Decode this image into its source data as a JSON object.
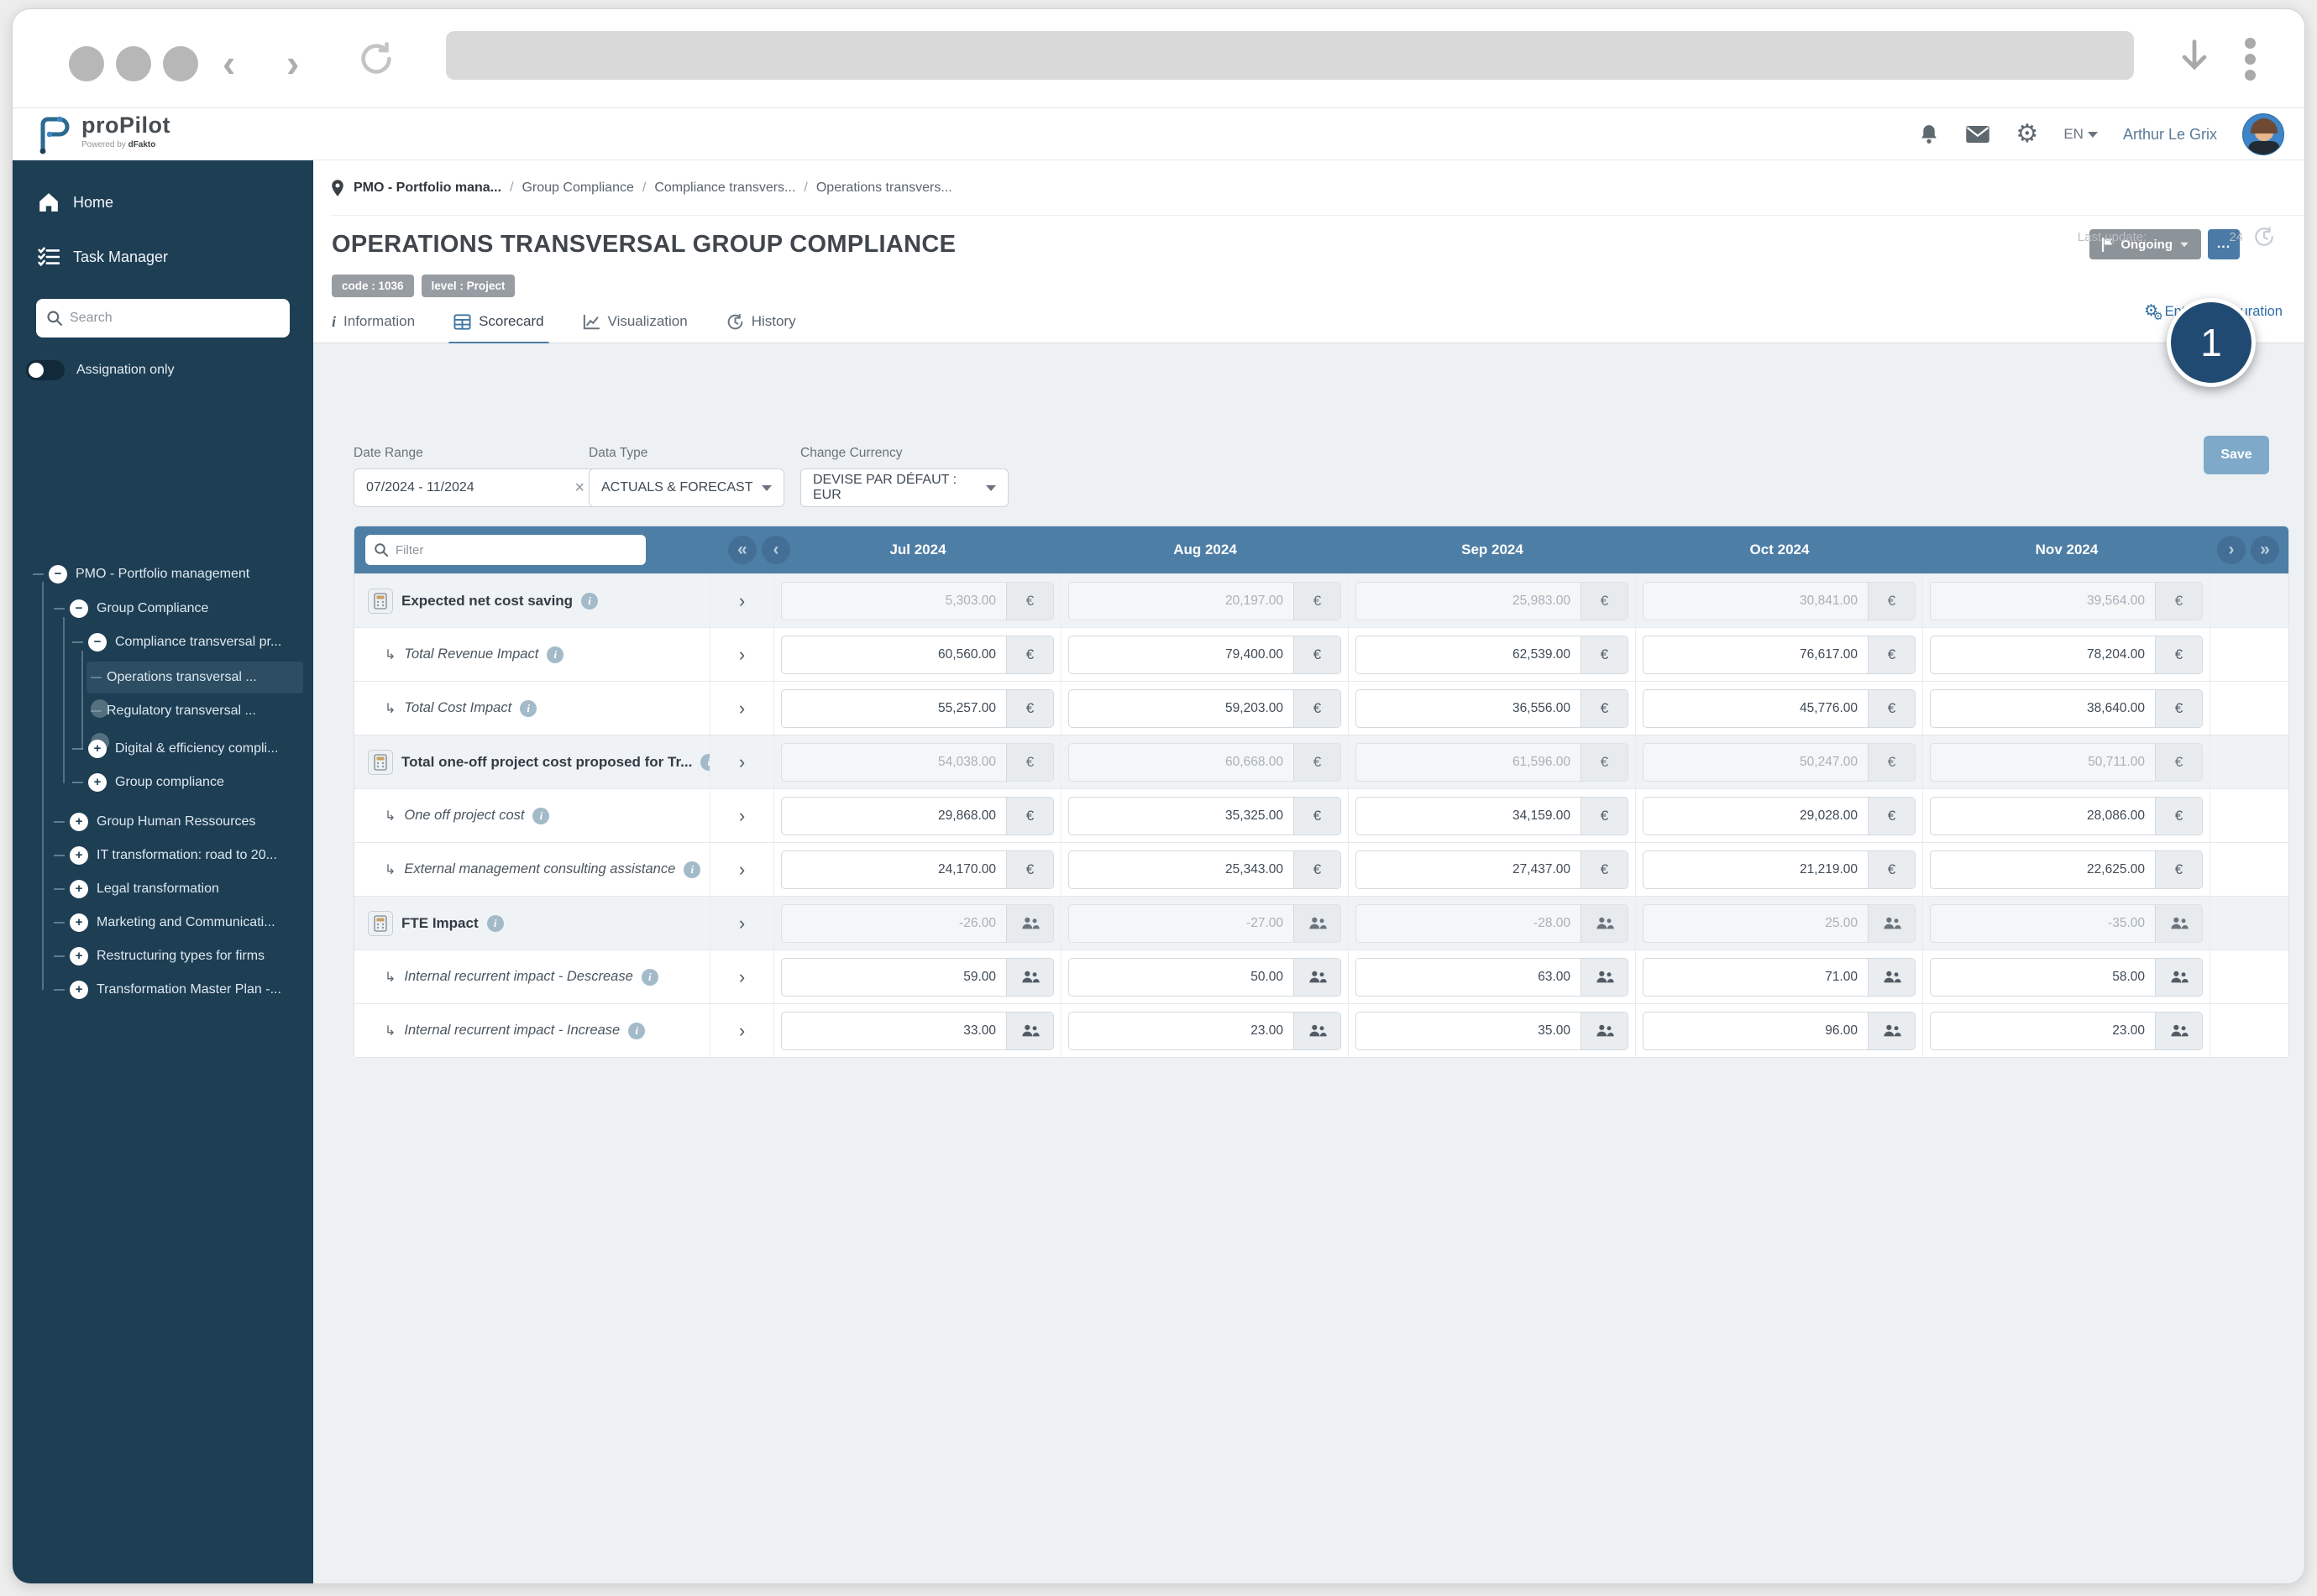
{
  "header": {
    "logo_text": "proPilot",
    "logo_sub_prefix": "Powered by ",
    "logo_sub_brand": "dFakto",
    "language": "EN",
    "user_name": "Arthur Le Grix"
  },
  "sidebar": {
    "home_label": "Home",
    "task_manager_label": "Task Manager",
    "search_placeholder": "Search",
    "toggle_label": "Assignation only",
    "tree": [
      {
        "label": "PMO - Portfolio management"
      },
      {
        "label": "Group Compliance"
      },
      {
        "label": "Compliance transversal pr..."
      },
      {
        "label": "Operations transversal ..."
      },
      {
        "label": "Regulatory transversal ..."
      },
      {
        "label": "Digital & efficiency compli..."
      },
      {
        "label": "Group compliance"
      },
      {
        "label": "Group Human Ressources"
      },
      {
        "label": "IT transformation: road to 20..."
      },
      {
        "label": "Legal transformation"
      },
      {
        "label": "Marketing and Communicati..."
      },
      {
        "label": "Restructuring types for firms"
      },
      {
        "label": "Transformation Master Plan -..."
      }
    ]
  },
  "breadcrumb": {
    "items": [
      "PMO - Portfolio mana...",
      "Group Compliance",
      "Compliance transvers...",
      "Operations transvers..."
    ],
    "separator": "/"
  },
  "page": {
    "title": "OPERATIONS TRANSVERSAL GROUP COMPLIANCE",
    "badges": [
      "code : 1036",
      "level : Project"
    ],
    "status_label": "Ongoing",
    "more_label": "...",
    "entity_config_label": "Entity configuration",
    "last_update_prefix": "Last update:",
    "last_update_suffix": "24"
  },
  "tabs": [
    {
      "label": "Information"
    },
    {
      "label": "Scorecard"
    },
    {
      "label": "Visualization"
    },
    {
      "label": "History"
    }
  ],
  "filters": {
    "date_range": {
      "label": "Date Range",
      "value": "07/2024 - 11/2024"
    },
    "data_type": {
      "label": "Data Type",
      "value": "ACTUALS & FORECAST"
    },
    "currency": {
      "label": "Change Currency",
      "value": "DEVISE PAR DÉFAUT : EUR"
    },
    "save_label": "Save",
    "filter_placeholder": "Filter"
  },
  "table": {
    "euro_symbol": "€",
    "columns": [
      "Jul 2024",
      "Aug 2024",
      "Sep 2024",
      "Oct 2024",
      "Nov 2024"
    ],
    "rows": [
      {
        "label": "Expected net cost saving",
        "type": "calc",
        "unit": "eur",
        "values": [
          "5,303.00",
          "20,197.00",
          "25,983.00",
          "30,841.00",
          "39,564.00"
        ]
      },
      {
        "label": "Total Revenue Impact",
        "type": "child",
        "unit": "eur",
        "values": [
          "60,560.00",
          "79,400.00",
          "62,539.00",
          "76,617.00",
          "78,204.00"
        ]
      },
      {
        "label": "Total Cost Impact",
        "type": "child",
        "unit": "eur",
        "values": [
          "55,257.00",
          "59,203.00",
          "36,556.00",
          "45,776.00",
          "38,640.00"
        ]
      },
      {
        "label": "Total one-off project cost proposed for Tr...",
        "type": "calc",
        "unit": "eur",
        "values": [
          "54,038.00",
          "60,668.00",
          "61,596.00",
          "50,247.00",
          "50,711.00"
        ]
      },
      {
        "label": "One off project cost",
        "type": "child",
        "unit": "eur",
        "values": [
          "29,868.00",
          "35,325.00",
          "34,159.00",
          "29,028.00",
          "28,086.00"
        ]
      },
      {
        "label": "External management consulting assistance",
        "type": "child",
        "unit": "eur",
        "values": [
          "24,170.00",
          "25,343.00",
          "27,437.00",
          "21,219.00",
          "22,625.00"
        ]
      },
      {
        "label": "FTE Impact",
        "type": "calc",
        "unit": "fte",
        "values": [
          "-26.00",
          "-27.00",
          "-28.00",
          "25.00",
          "-35.00"
        ]
      },
      {
        "label": "Internal recurrent impact - Descrease",
        "type": "child",
        "unit": "fte",
        "values": [
          "59.00",
          "50.00",
          "63.00",
          "71.00",
          "58.00"
        ]
      },
      {
        "label": "Internal recurrent impact - Increase",
        "type": "child",
        "unit": "fte",
        "values": [
          "33.00",
          "23.00",
          "35.00",
          "96.00",
          "23.00"
        ]
      }
    ]
  },
  "annotation": {
    "label": "1"
  },
  "colors": {
    "accent_blue": "#2e6da4",
    "header_blue": "#4d7ea6",
    "sidebar_navy": "#1e3e54",
    "annotation_navy": "#214a72"
  }
}
